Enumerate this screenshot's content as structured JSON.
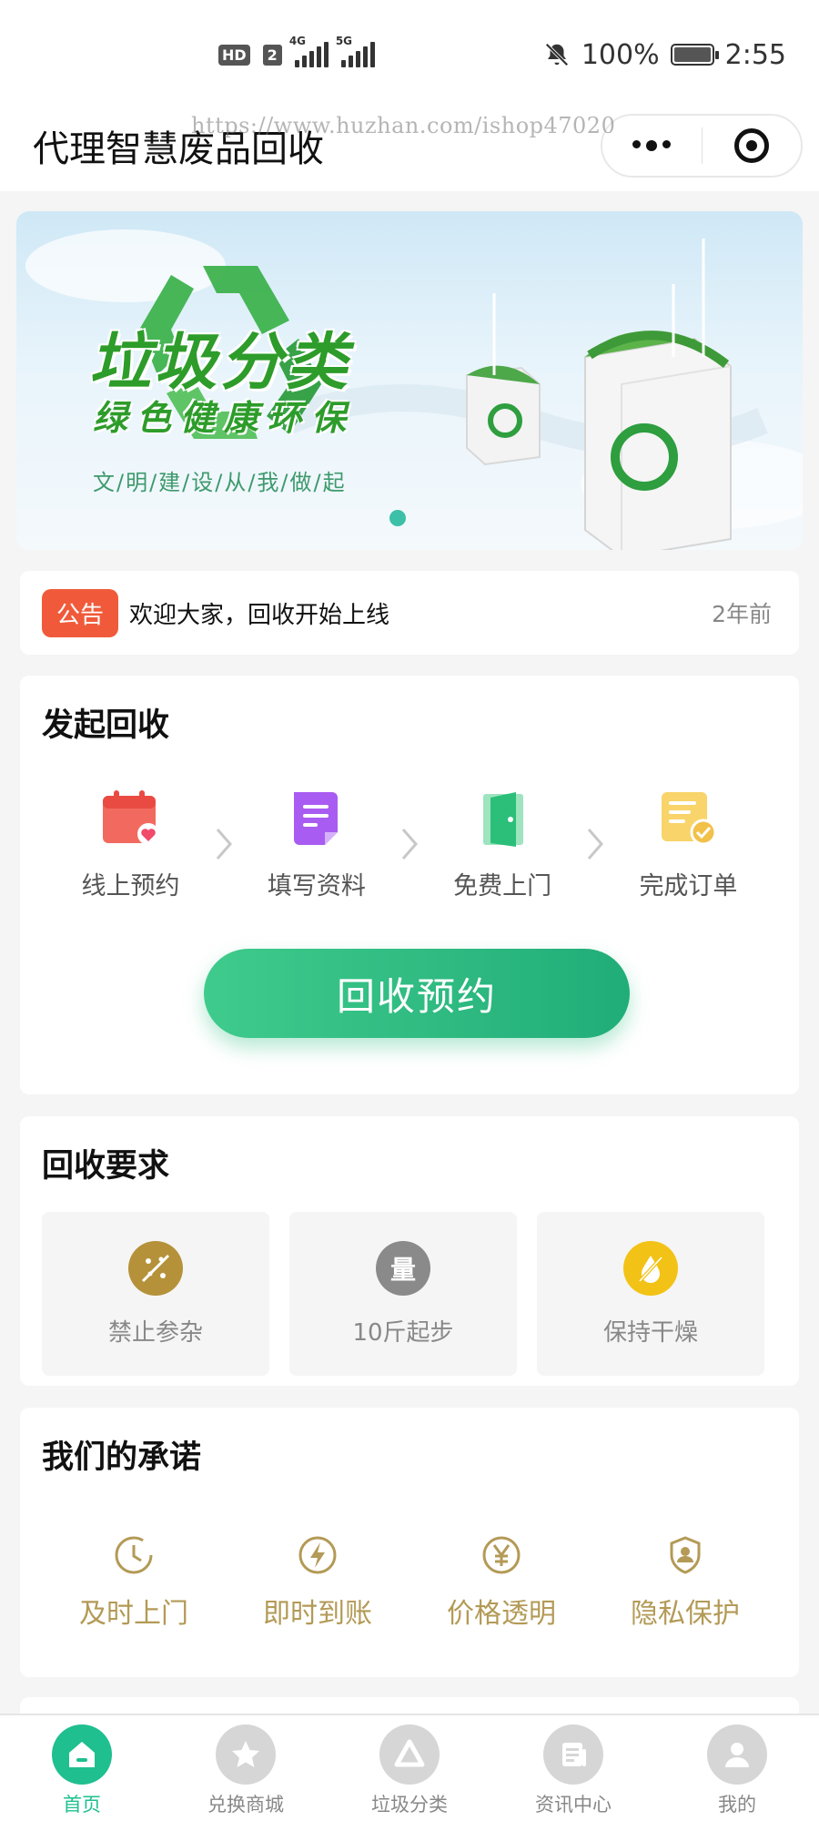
{
  "status_bar": {
    "hd": "HD",
    "sim": "2",
    "net1": "4G",
    "net2": "5G",
    "battery_pct": "100%",
    "time": "2:55"
  },
  "header": {
    "title": "代理智慧废品回收",
    "watermark": "https://www.huzhan.com/ishop47020"
  },
  "banner": {
    "title": "垃圾分类",
    "subtitle": "绿色健康环保",
    "tagline": "文/明/建/设/从/我/做/起"
  },
  "notice": {
    "badge": "公告",
    "text": "欢迎大家，回收开始上线",
    "time": "2年前"
  },
  "launch": {
    "title": "发起回收",
    "steps": [
      {
        "label": "线上预约",
        "icon": "calendar-heart-icon",
        "color": "#f0554f"
      },
      {
        "label": "填写资料",
        "icon": "form-icon",
        "color": "#a45cf0"
      },
      {
        "label": "免费上门",
        "icon": "door-icon",
        "color": "#2bbf7a"
      },
      {
        "label": "完成订单",
        "icon": "order-check-icon",
        "color": "#f5c24a"
      }
    ],
    "button": "回收预约"
  },
  "requirements": {
    "title": "回收要求",
    "items": [
      {
        "label": "禁止参杂",
        "icon_text": "",
        "color": "#b5923a"
      },
      {
        "label": "10斤起步",
        "icon_text": "量",
        "color": "#8a8a8a"
      },
      {
        "label": "保持干燥",
        "icon_text": "",
        "color": "#f2c316"
      }
    ]
  },
  "promise": {
    "title": "我们的承诺",
    "items": [
      {
        "label": "及时上门",
        "icon": "clock-icon"
      },
      {
        "label": "即时到账",
        "icon": "lightning-icon"
      },
      {
        "label": "价格透明",
        "icon": "yen-icon"
      },
      {
        "label": "隐私保护",
        "icon": "shield-user-icon"
      }
    ],
    "color": "#b39a56"
  },
  "tabbar": {
    "items": [
      {
        "label": "首页",
        "active": true
      },
      {
        "label": "兑换商城",
        "active": false
      },
      {
        "label": "垃圾分类",
        "active": false
      },
      {
        "label": "资讯中心",
        "active": false
      },
      {
        "label": "我的",
        "active": false
      }
    ],
    "active_color": "#1fbf8f"
  }
}
